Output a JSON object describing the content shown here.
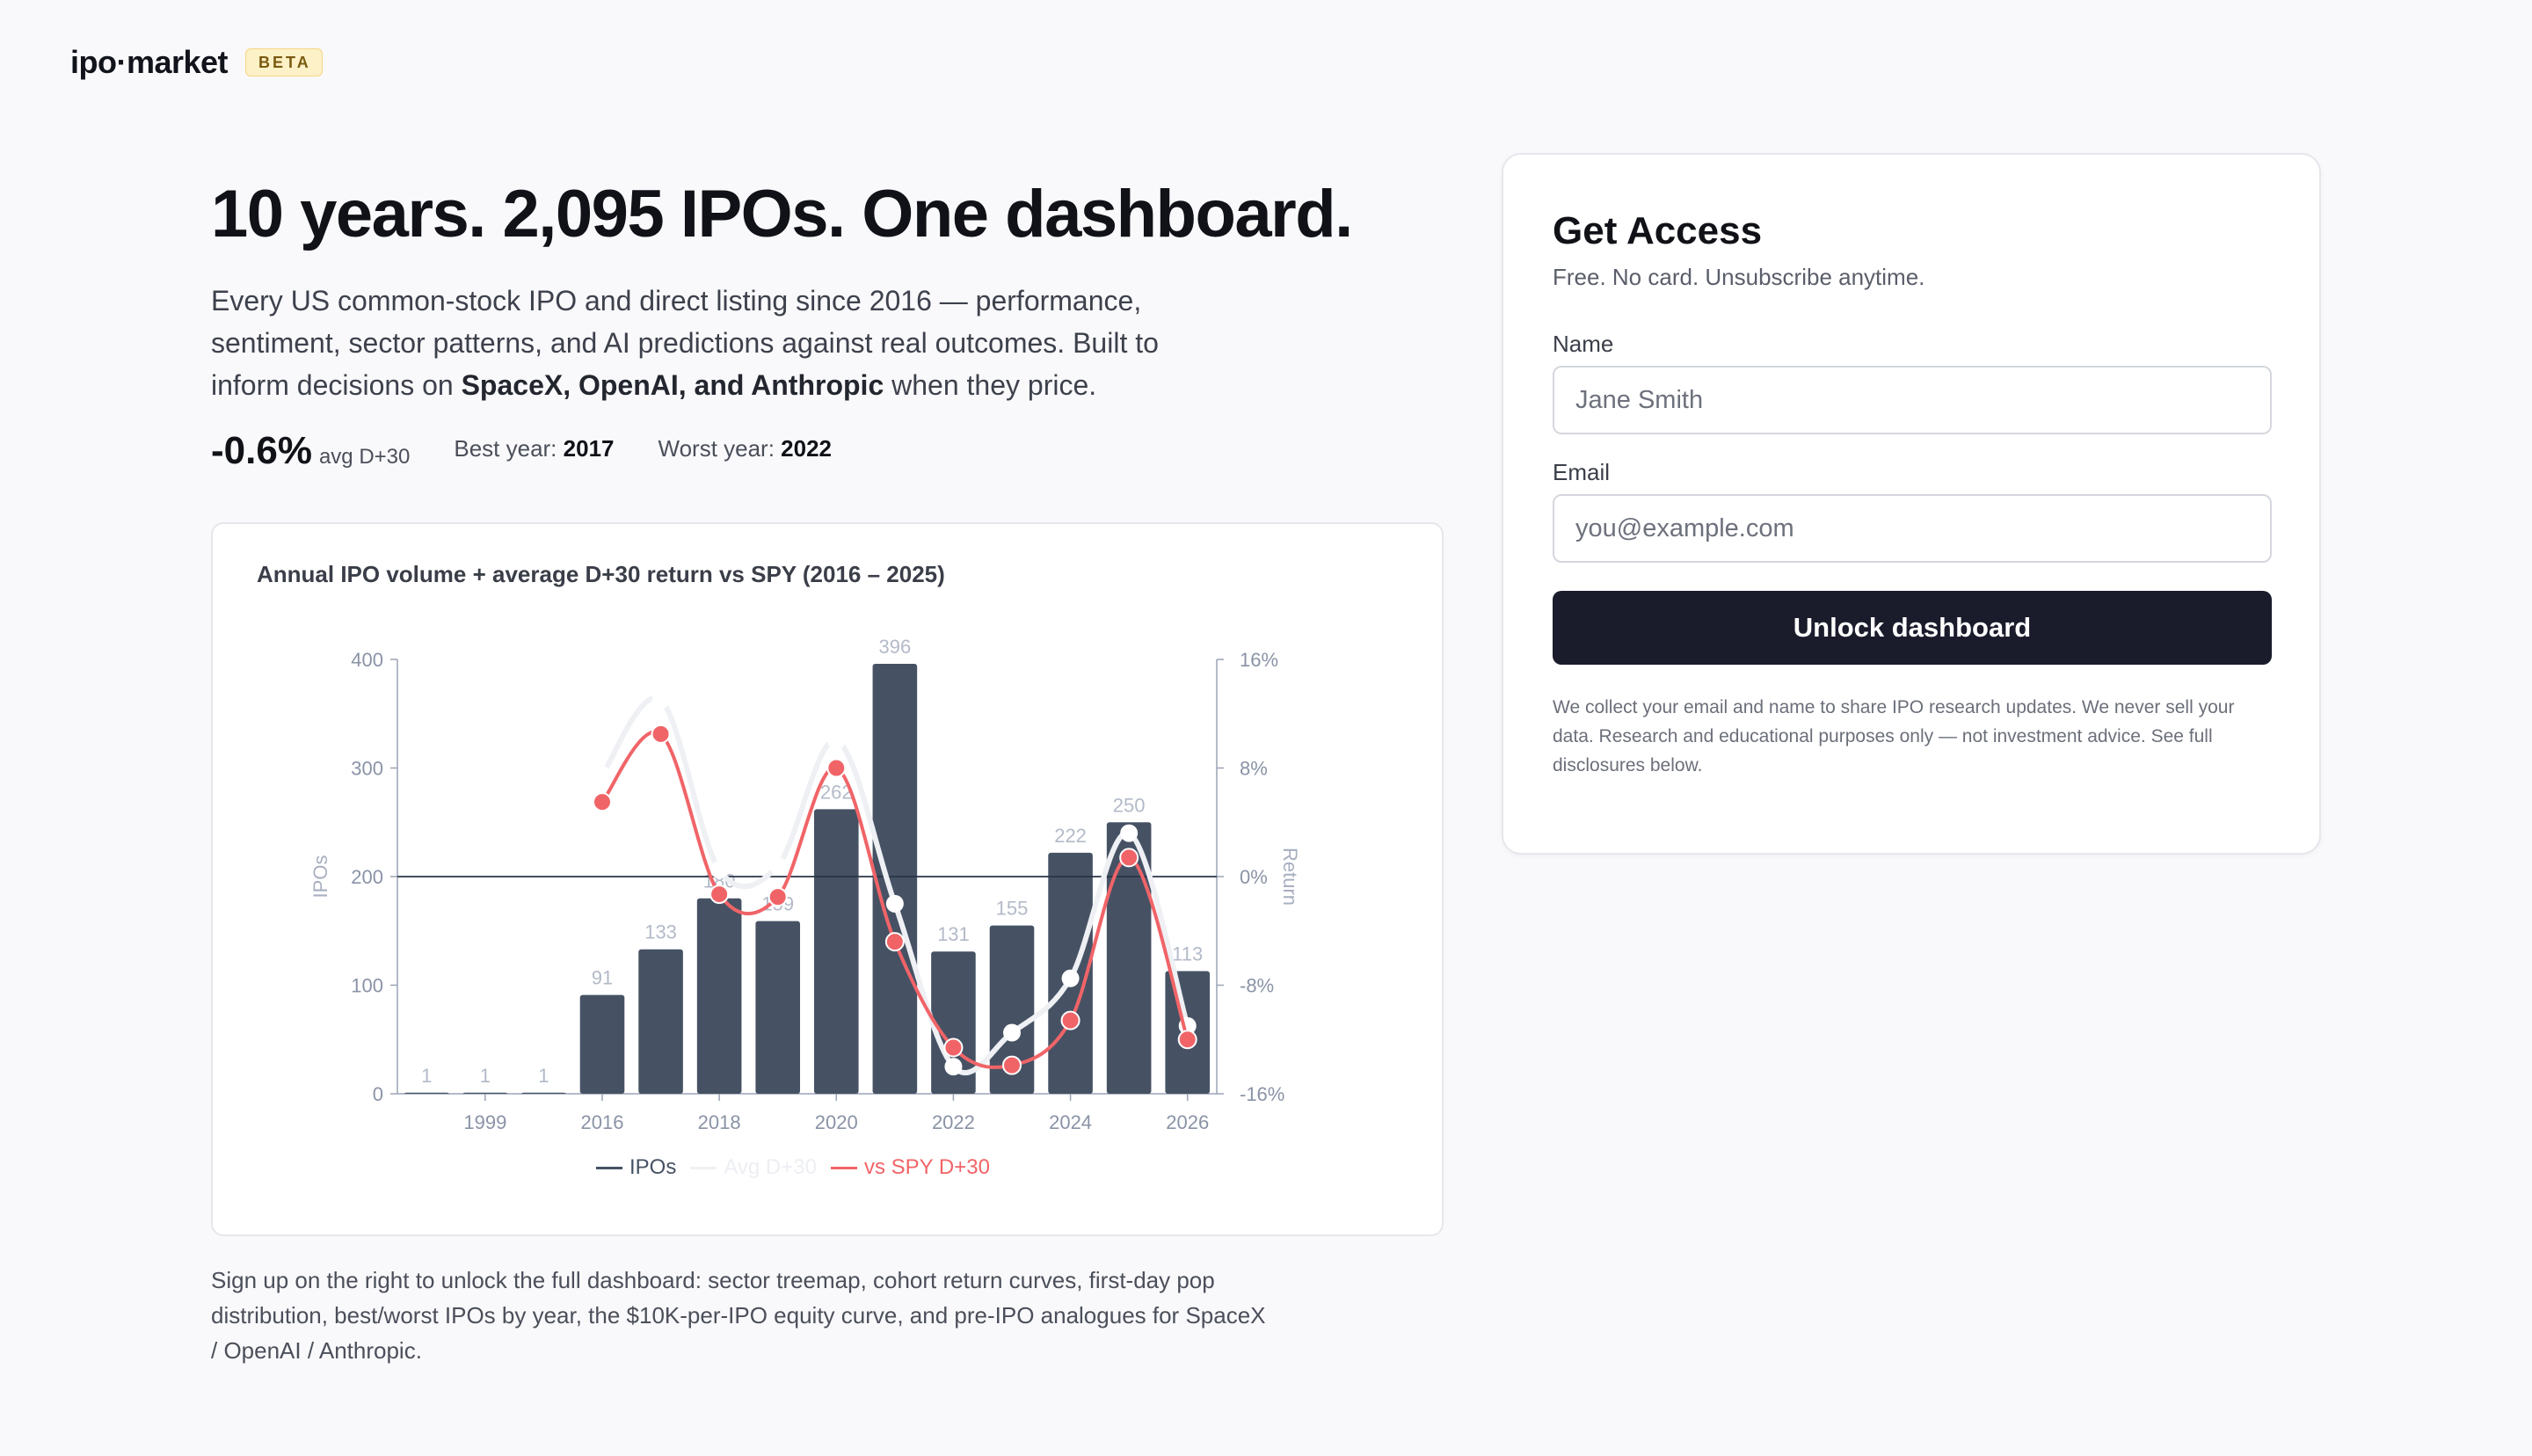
{
  "brand": {
    "name": "ipo·market",
    "badge": "BETA"
  },
  "hero": {
    "title": "10 years. 2,095 IPOs. One dashboard.",
    "desc_part1": "Every US common-stock IPO and direct listing since 2016 — performance, sentiment, sector patterns, and AI predictions against real outcomes. Built to inform decisions on ",
    "desc_bold": "SpaceX, OpenAI, and Anthropic",
    "desc_part2": " when they price."
  },
  "stats": {
    "avg_value": "-0.6%",
    "avg_label": "avg D+30",
    "best_label": "Best year:",
    "best_value": "2017",
    "worst_label": "Worst year:",
    "worst_value": "2022"
  },
  "chart_title": "Annual IPO volume + average D+30 return vs SPY (2016 – 2025)",
  "chart_data": {
    "type": "bar",
    "title": "Annual IPO volume + average D+30 return vs SPY (2016 – 2025)",
    "x_ticks": [
      "1999",
      "2016",
      "2018",
      "2020",
      "2022",
      "2024",
      "2026"
    ],
    "y_left_label": "IPOs",
    "y_left_ticks": [
      "0",
      "100",
      "200",
      "300",
      "400"
    ],
    "y_left_range": [
      0,
      400
    ],
    "y_right_label": "Return",
    "y_right_ticks": [
      "-16%",
      "-8%",
      "0%",
      "8%",
      "16%"
    ],
    "y_right_range": [
      -16,
      16
    ],
    "categories": [
      "1997",
      "1999",
      "2001",
      "2016",
      "2017",
      "2018",
      "2019",
      "2020",
      "2021",
      "2022",
      "2023",
      "2024",
      "2025",
      "2026"
    ],
    "series": [
      {
        "name": "IPOs",
        "type": "bar",
        "color": "#465264",
        "values": [
          1,
          1,
          1,
          91,
          133,
          180,
          159,
          262,
          396,
          131,
          155,
          222,
          250,
          113
        ]
      },
      {
        "name": "Avg D+30",
        "type": "line",
        "color": "#eef0f4",
        "x": [
          "2016",
          "2017",
          "2018",
          "2019",
          "2020",
          "2021",
          "2022",
          "2023",
          "2024",
          "2025",
          "2026"
        ],
        "values": [
          7.5,
          13,
          0.5,
          0.8,
          10,
          -2,
          -14,
          -11.5,
          -7.5,
          3.2,
          -11
        ]
      },
      {
        "name": "vs SPY D+30",
        "type": "line",
        "color": "#f06468",
        "x": [
          "2016",
          "2017",
          "2018",
          "2019",
          "2020",
          "2021",
          "2022",
          "2023",
          "2024",
          "2025",
          "2026"
        ],
        "values": [
          5.5,
          10.5,
          -1.3,
          -1.5,
          8,
          -4.8,
          -12.6,
          -13.9,
          -10.6,
          1.4,
          -12
        ]
      }
    ],
    "zero_line": true
  },
  "legend": {
    "ipos": "IPOs",
    "avg": "Avg D+30",
    "spy": "vs SPY D+30"
  },
  "footnote": "Sign up on the right to unlock the full dashboard: sector treemap, cohort return curves, first-day pop distribution, best/worst IPOs by year, the $10K-per-IPO equity curve, and pre-IPO analogues for SpaceX / OpenAI / Anthropic.",
  "access": {
    "title": "Get Access",
    "subtitle": "Free. No card. Unsubscribe anytime.",
    "name_label": "Name",
    "name_placeholder": "Jane Smith",
    "email_label": "Email",
    "email_placeholder": "you@example.com",
    "button": "Unlock dashboard",
    "disclaimer": "We collect your email and name to share IPO research updates. We never sell your data. Research and educational purposes only — not investment advice. See full disclosures below."
  }
}
